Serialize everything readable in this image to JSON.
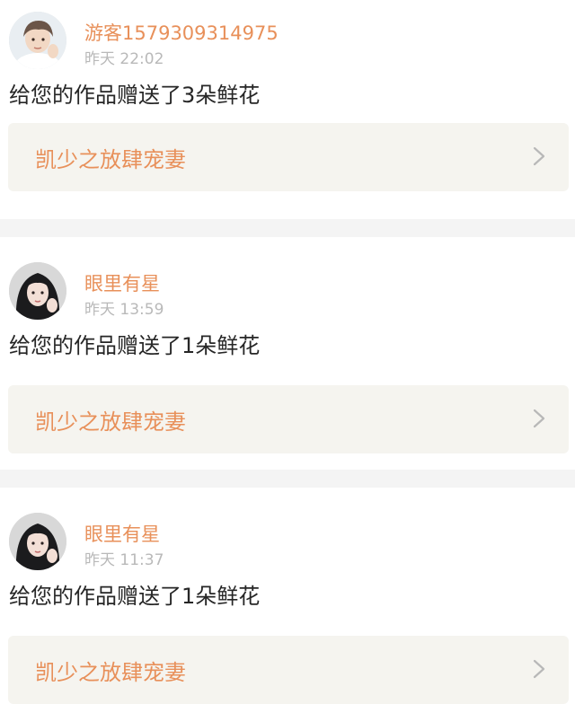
{
  "notifications": [
    {
      "avatar": "boy-avatar",
      "username": "游客1579309314975",
      "time": "昨天 22:02",
      "message": "给您的作品赠送了3朵鲜花",
      "work_title": "凯少之放肆宠妻",
      "chevron": "chevron-right-icon"
    },
    {
      "avatar": "girl-avatar",
      "username": "眼里有星",
      "time": "昨天 13:59",
      "message": "给您的作品赠送了1朵鲜花",
      "work_title": "凯少之放肆宠妻",
      "chevron": "chevron-right-icon"
    },
    {
      "avatar": "girl-avatar",
      "username": "眼里有星",
      "time": "昨天 11:37",
      "message": "给您的作品赠送了1朵鲜花",
      "work_title": "凯少之放肆宠妻",
      "chevron": "chevron-right-icon"
    }
  ],
  "colors": {
    "accent": "#e8905a",
    "muted": "#b9b9b9",
    "text": "#262626",
    "link_bg": "#f5f4ef",
    "divider": "#f4f4f4"
  }
}
